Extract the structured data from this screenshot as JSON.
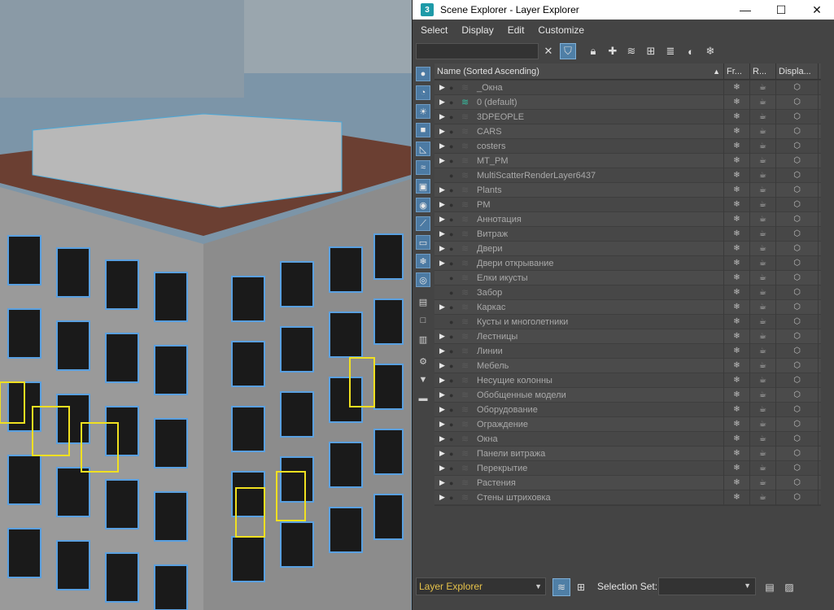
{
  "window": {
    "app_icon": "3",
    "title": "Scene Explorer - Layer Explorer",
    "controls": {
      "minimize": "—",
      "maximize": "☐",
      "close": "✕"
    }
  },
  "menu": [
    "Select",
    "Display",
    "Edit",
    "Customize"
  ],
  "toolbar": {
    "search_value": "",
    "icons": [
      "clear-search-icon",
      "filter-icon",
      "lock-icon",
      "add-layer-icon",
      "layers-icon",
      "add-to-layer-icon",
      "stack-icon",
      "layer-props-icon",
      "freeze-icon"
    ]
  },
  "columns": {
    "name": "Name (Sorted Ascending)",
    "frozen": "Fr...",
    "render": "R...",
    "display": "Displa..."
  },
  "layers": [
    {
      "name": "_Окна",
      "expandable": true,
      "active": false
    },
    {
      "name": "0 (default)",
      "expandable": true,
      "active": true
    },
    {
      "name": "3DPEOPLE",
      "expandable": true,
      "active": false
    },
    {
      "name": "CARS",
      "expandable": true,
      "active": false
    },
    {
      "name": "costers",
      "expandable": true,
      "active": false
    },
    {
      "name": "MT_PM",
      "expandable": true,
      "active": false
    },
    {
      "name": "MultiScatterRenderLayer6437",
      "expandable": false,
      "active": false
    },
    {
      "name": "Plants",
      "expandable": true,
      "active": false
    },
    {
      "name": "PM",
      "expandable": true,
      "active": false
    },
    {
      "name": "Аннотация",
      "expandable": true,
      "active": false
    },
    {
      "name": "Витраж",
      "expandable": true,
      "active": false
    },
    {
      "name": "Двери",
      "expandable": true,
      "active": false
    },
    {
      "name": "Двери открывание",
      "expandable": true,
      "active": false
    },
    {
      "name": "Елки икусты",
      "expandable": false,
      "active": false
    },
    {
      "name": "Забор",
      "expandable": false,
      "active": false
    },
    {
      "name": "Каркас",
      "expandable": true,
      "active": false
    },
    {
      "name": "Кусты и многолетники",
      "expandable": false,
      "active": false
    },
    {
      "name": "Лестницы",
      "expandable": true,
      "active": false
    },
    {
      "name": "Линии",
      "expandable": true,
      "active": false
    },
    {
      "name": "Мебель",
      "expandable": true,
      "active": false
    },
    {
      "name": "Несущие колонны",
      "expandable": true,
      "active": false
    },
    {
      "name": "Обобщенные модели",
      "expandable": true,
      "active": false
    },
    {
      "name": "Оборудование",
      "expandable": true,
      "active": false
    },
    {
      "name": "Ограждение",
      "expandable": true,
      "active": false
    },
    {
      "name": "Окна",
      "expandable": true,
      "active": false
    },
    {
      "name": "Панели витража",
      "expandable": true,
      "active": false
    },
    {
      "name": "Перекрытие",
      "expandable": true,
      "active": false
    },
    {
      "name": "Растения",
      "expandable": true,
      "active": false
    },
    {
      "name": "Стены штриховка",
      "expandable": true,
      "active": false
    }
  ],
  "bottom": {
    "explorer": "Layer Explorer",
    "selection_set_label": "Selection Set:",
    "selection_set_value": ""
  },
  "colors": {
    "accent": "#4f7fa6",
    "active_layer": "#35c2a4",
    "explorer_text": "#e6c24a"
  }
}
